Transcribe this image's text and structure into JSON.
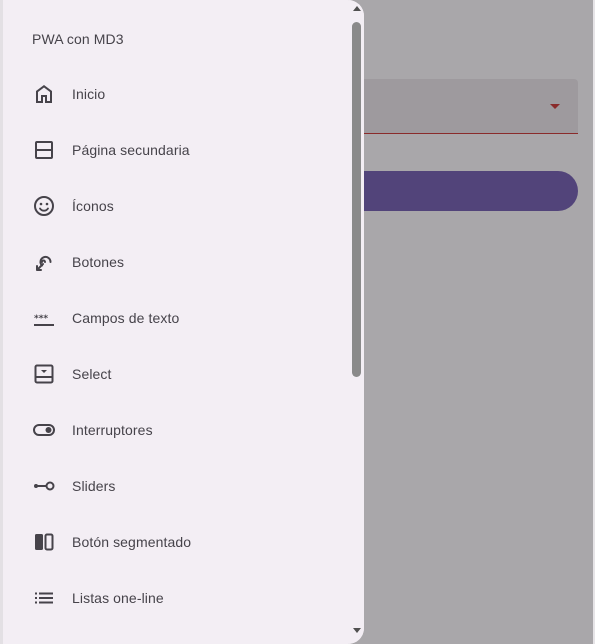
{
  "drawer": {
    "title": "PWA con MD3",
    "items": [
      {
        "label": "Inicio",
        "icon": "home-icon"
      },
      {
        "label": "Página secundaria",
        "icon": "split-panel-icon"
      },
      {
        "label": "Íconos",
        "icon": "smiley-icon"
      },
      {
        "label": "Botones",
        "icon": "touch-icon"
      },
      {
        "label": "Campos de texto",
        "icon": "password-field-icon"
      },
      {
        "label": "Select",
        "icon": "select-box-icon"
      },
      {
        "label": "Interruptores",
        "icon": "toggle-icon"
      },
      {
        "label": "Sliders",
        "icon": "slider-icon"
      },
      {
        "label": "Botón segmentado",
        "icon": "segmented-icon"
      },
      {
        "label": "Listas one-line",
        "icon": "list-icon"
      }
    ]
  },
  "colors": {
    "drawer_bg": "#f3eef4",
    "scrim": "#a9a7aa",
    "primary": "#52447a",
    "error": "#8a2b2b",
    "text": "#46434a"
  }
}
